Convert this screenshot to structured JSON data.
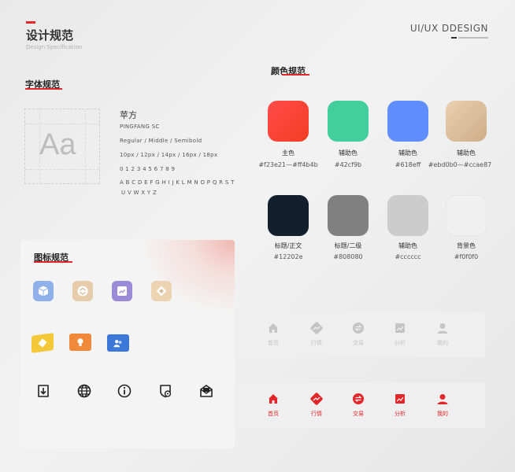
{
  "header": {
    "title": "设计规范",
    "subtitle": "Design Specification",
    "brand": "UI/UX DDESIGN"
  },
  "typography": {
    "heading": "字体规范",
    "sample": "Aa",
    "font_name": "苹方",
    "font_en": "PINGFANG SC",
    "weights": "Regular / Middle / Semibold",
    "sizes": "10px  /  12px  /  14px  /  16px  /  18px",
    "digits": "0 1 2 3 4 5 6 7 8 9",
    "letters_1": "A B C D E F G H I J K L M N O P Q R S T",
    "letters_2": "U V W X Y Z"
  },
  "colors": {
    "heading": "颜色规范",
    "swatches": [
      {
        "label": "主色",
        "code": "#f23e21—#ff4b4b",
        "fill": "#ff4b4b",
        "fill2": "#f23e21"
      },
      {
        "label": "辅助色",
        "code": "#42cf9b",
        "fill": "#42cf9b",
        "fill2": "#42cf9b"
      },
      {
        "label": "辅助色",
        "code": "#618eff",
        "fill": "#618eff",
        "fill2": "#618eff"
      },
      {
        "label": "辅助色",
        "code": "#ebd0b0—#ccae87",
        "fill": "#ebd0b0",
        "fill2": "#ccae87"
      },
      {
        "label": "标题/正文",
        "code": "#12202e",
        "fill": "#12202e",
        "fill2": "#12202e"
      },
      {
        "label": "标题/二级",
        "code": "#808080",
        "fill": "#808080",
        "fill2": "#808080"
      },
      {
        "label": "辅助色",
        "code": "#cccccc",
        "fill": "#cccccc",
        "fill2": "#cccccc"
      },
      {
        "label": "背景色",
        "code": "#f0f0f0",
        "fill": "#f0f0f0",
        "fill2": "#f0f0f0"
      }
    ]
  },
  "icons": {
    "heading": "图标规范"
  },
  "tabbar_inactive": {
    "color": "#c4c4c4",
    "tabs": [
      "首页",
      "行情",
      "交易",
      "分析",
      "我的"
    ]
  },
  "tabbar_active": {
    "color": "#e3262a",
    "tabs": [
      "首页",
      "行情",
      "交易",
      "分析",
      "我的"
    ]
  }
}
